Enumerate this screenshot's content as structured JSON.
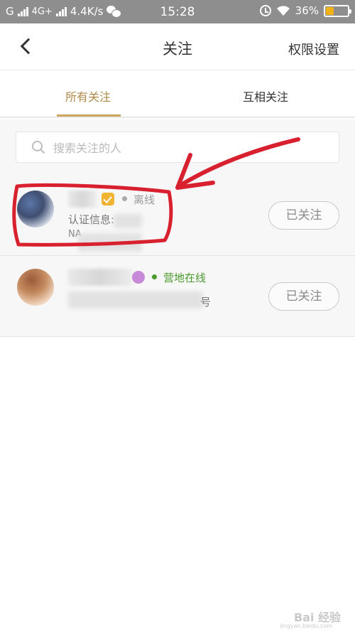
{
  "status_bar": {
    "carrier": "G",
    "network": "4G+",
    "speed": "4.4K/s",
    "time": "15:28",
    "battery": "36%",
    "battery_level": 0.36
  },
  "header": {
    "title": "关注",
    "back_icon": "chevron-left-icon",
    "permission_label": "权限设置"
  },
  "tabs": [
    {
      "label": "所有关注",
      "active": true
    },
    {
      "label": "互相关注",
      "active": false
    }
  ],
  "search": {
    "placeholder": "搜索关注的人",
    "icon": "search-icon"
  },
  "list": [
    {
      "status": "离线",
      "status_color": "#999999",
      "subtitle": "认证信息:",
      "third_line": "NA",
      "button": "已关注"
    },
    {
      "status": "营地在线",
      "status_color": "#4a9a2e",
      "subtitle": "",
      "third_line": "",
      "subtitle_tail": "号",
      "button": "已关注"
    }
  ],
  "colors": {
    "accent": "#c9a25c",
    "tab_active": "#b08a4a",
    "annotation": "#d8202f"
  },
  "watermark": {
    "text": "Bai 经验",
    "sub": "jingyan.baidu.com"
  }
}
